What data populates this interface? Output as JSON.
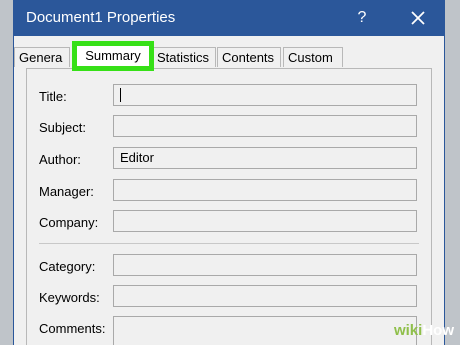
{
  "window": {
    "title": "Document1 Properties",
    "help_glyph": "?",
    "close_icon": "close-icon"
  },
  "tabs": [
    {
      "label": "Genera",
      "active": false
    },
    {
      "label": "Summary",
      "active": true
    },
    {
      "label": "Statistics",
      "active": false
    },
    {
      "label": "Contents",
      "active": false
    },
    {
      "label": "Custom",
      "active": false
    }
  ],
  "fields": {
    "title": {
      "label": "Title:",
      "value": ""
    },
    "subject": {
      "label": "Subject:",
      "value": ""
    },
    "author": {
      "label": "Author:",
      "value": "Editor"
    },
    "manager": {
      "label": "Manager:",
      "value": ""
    },
    "company": {
      "label": "Company:",
      "value": ""
    },
    "category": {
      "label": "Category:",
      "value": ""
    },
    "keywords": {
      "label": "Keywords:",
      "value": ""
    },
    "comments": {
      "label": "Comments:",
      "value": ""
    }
  },
  "watermark": {
    "part1": "wiki",
    "part2": "How"
  },
  "colors": {
    "titlebar": "#2b579a",
    "highlight": "#36e017"
  }
}
